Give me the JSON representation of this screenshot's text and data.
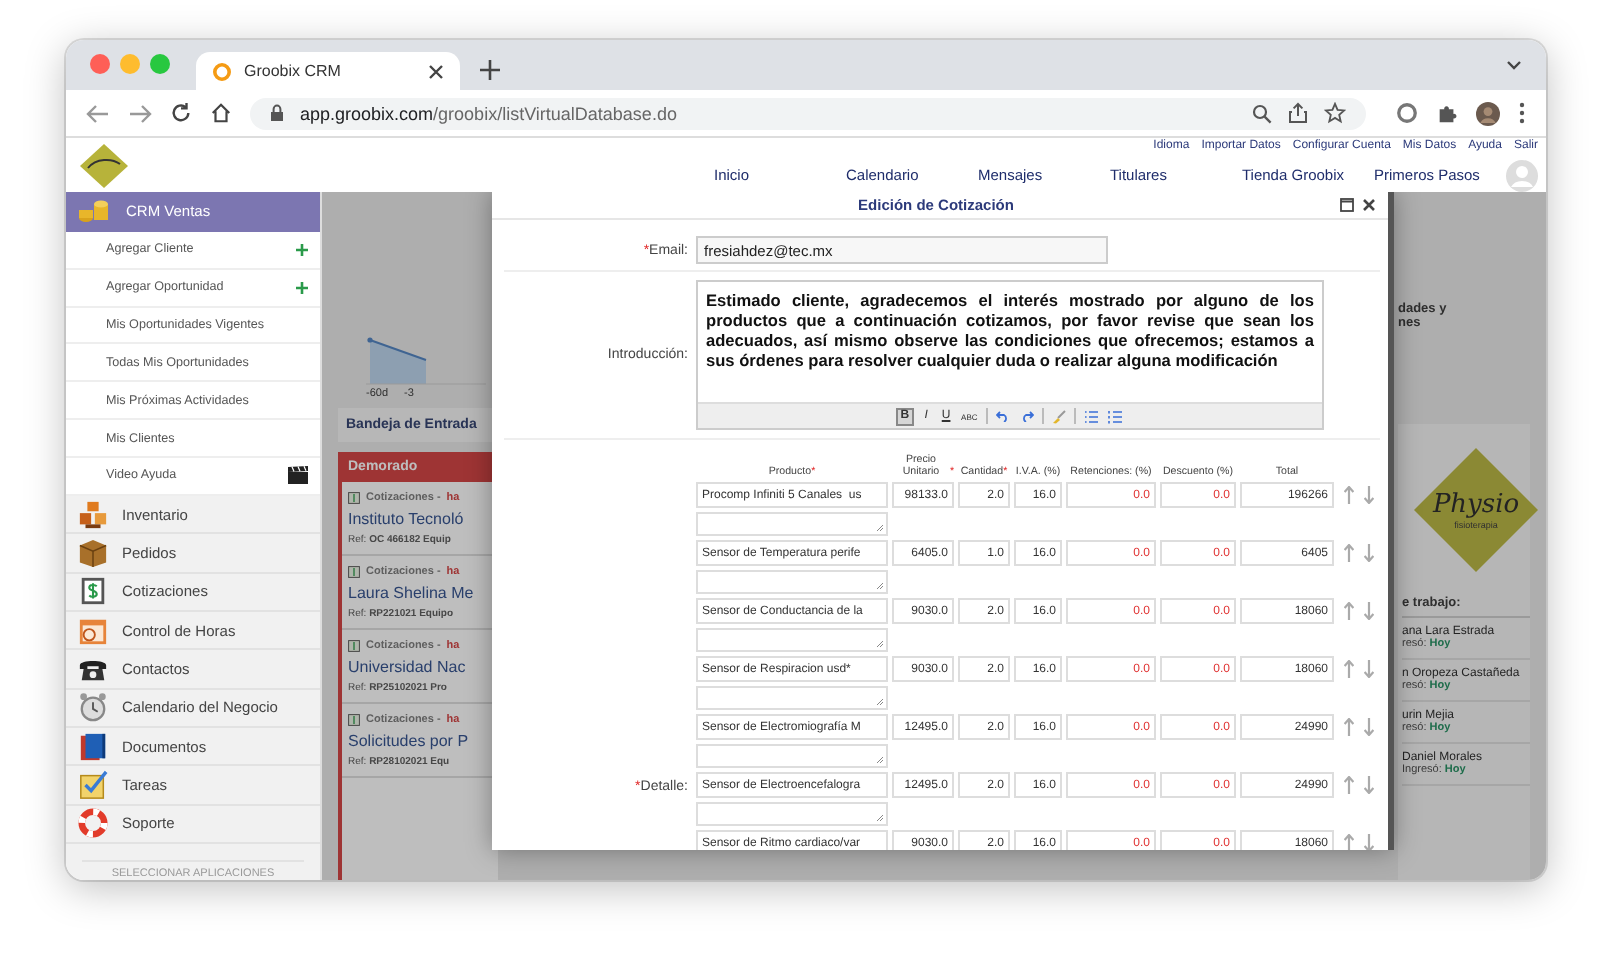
{
  "browser": {
    "tab_title": "Groobix CRM",
    "url_host": "app.groobix.com",
    "url_path": "/groobix/listVirtualDatabase.do"
  },
  "header": {
    "top_links": [
      "Idioma",
      "Importar Datos",
      "Configurar Cuenta",
      "Mis Datos",
      "Ayuda",
      "Salir"
    ],
    "nav": [
      "Inicio",
      "Calendario",
      "Mensajes",
      "Titulares",
      "Tienda Groobix",
      "Primeros Pasos"
    ]
  },
  "sidebar": {
    "section": {
      "label": "CRM Ventas",
      "expanded": true
    },
    "sub_items": [
      {
        "label": "Agregar Cliente",
        "kind": "add"
      },
      {
        "label": "Agregar Oportunidad",
        "kind": "add"
      },
      {
        "label": "Mis Oportunidades Vigentes",
        "kind": "link"
      },
      {
        "label": "Todas Mis Oportunidades",
        "kind": "link"
      },
      {
        "label": "Mis Próximas Actividades",
        "kind": "link"
      },
      {
        "label": "Mis Clientes",
        "kind": "link"
      },
      {
        "label": "Video Ayuda",
        "kind": "video"
      }
    ],
    "apps": [
      "Inventario",
      "Pedidos",
      "Cotizaciones",
      "Control de Horas",
      "Contactos",
      "Calendario del Negocio",
      "Documentos",
      "Tareas",
      "Soporte"
    ],
    "footer": "SELECCIONAR APLICACIONES"
  },
  "background": {
    "chart_ticks": [
      "-60d",
      "-3"
    ],
    "inbox_tab": "Bandeja de Entrada",
    "panel_title": "Demorado",
    "items": [
      {
        "category": "Cotizaciones -",
        "note": "ha",
        "title": "Instituto Tecnoló",
        "ref": "Ref: **OC 466182 Equip**"
      },
      {
        "category": "Cotizaciones -",
        "note": "ha",
        "title": "Laura Shelina Me",
        "ref": "Ref: **RP221021 Equipo**"
      },
      {
        "category": "Cotizaciones -",
        "note": "ha",
        "title": "Universidad Nac",
        "ref": "Ref: **RP25102021 Pro**"
      },
      {
        "category": "Cotizaciones -",
        "note": "ha",
        "title": "Solicitudes por P",
        "ref": "Ref: **RP28102021 Equ**"
      }
    ],
    "side_text": [
      "dades y",
      "nes"
    ],
    "logo_text": "Physio",
    "logo_subtext": "fisioterapia",
    "team_title": "e trabajo:",
    "team": [
      {
        "name": "ana Lara Estrada",
        "status": "resó:",
        "when": "Hoy"
      },
      {
        "name": "n Oropeza Castañeda",
        "status": "resó:",
        "when": "Hoy"
      },
      {
        "name": "urin Mejia",
        "status": "resó:",
        "when": "Hoy"
      },
      {
        "name": "Daniel Morales",
        "status": "Ingresó:",
        "when": "Hoy"
      }
    ]
  },
  "dialog": {
    "title": "Edición de Cotización",
    "required_mark": "*",
    "email": {
      "label": "Email:",
      "required": true,
      "value": "fresiahdez@tec.mx"
    },
    "introduction": {
      "label": "Introducción:",
      "required": false,
      "text": "Estimado cliente, agradecemos el interés mostrado por alguno de los productos que a continuación cotizamos, por favor revise que sean los adecuados, así mismo observe las condiciones que ofrecemos; estamos a sus órdenes para resolver cualquier duda o realizar alguna modificación",
      "toolbar": [
        {
          "kind": "text",
          "label": "B",
          "selected": true
        },
        {
          "kind": "text",
          "label": "I",
          "selected": false
        },
        {
          "kind": "text",
          "label": "U",
          "selected": false
        },
        {
          "kind": "text",
          "label": "ABC",
          "selected": false
        },
        {
          "kind": "undo",
          "selected": false
        },
        {
          "kind": "redo",
          "selected": false
        },
        {
          "kind": "clear",
          "selected": false
        },
        {
          "kind": "bullets",
          "selected": false
        },
        {
          "kind": "numbers",
          "selected": false
        }
      ]
    },
    "detail": {
      "label": "Detalle:",
      "required": true,
      "columns": [
        {
          "label": "Producto",
          "required": true
        },
        {
          "label": "Precio Unitario",
          "required": true
        },
        {
          "label": "Cantidad",
          "required": true
        },
        {
          "label": "I.V.A. (%)",
          "required": false
        },
        {
          "label": "Retenciones: (%)",
          "required": false
        },
        {
          "label": "Descuento (%)",
          "required": false
        },
        {
          "label": "Total",
          "required": false
        }
      ],
      "rows": [
        {
          "product": "Procomp Infiniti 5 Canales  us",
          "unit_price": "98133.0",
          "quantity": "2.0",
          "vat": "16.0",
          "retention": "0.0",
          "discount": "0.0",
          "total": "196266"
        },
        {
          "product": "Sensor de Temperatura perife",
          "unit_price": "6405.0",
          "quantity": "1.0",
          "vat": "16.0",
          "retention": "0.0",
          "discount": "0.0",
          "total": "6405"
        },
        {
          "product": "Sensor de Conductancia de la",
          "unit_price": "9030.0",
          "quantity": "2.0",
          "vat": "16.0",
          "retention": "0.0",
          "discount": "0.0",
          "total": "18060"
        },
        {
          "product": "Sensor de Respiracion usd*",
          "unit_price": "9030.0",
          "quantity": "2.0",
          "vat": "16.0",
          "retention": "0.0",
          "discount": "0.0",
          "total": "18060"
        },
        {
          "product": "Sensor de Electromiografía M",
          "unit_price": "12495.0",
          "quantity": "2.0",
          "vat": "16.0",
          "retention": "0.0",
          "discount": "0.0",
          "total": "24990"
        },
        {
          "product": "Sensor de Electroencefalogra",
          "unit_price": "12495.0",
          "quantity": "2.0",
          "vat": "16.0",
          "retention": "0.0",
          "discount": "0.0",
          "total": "24990"
        },
        {
          "product": "Sensor de Ritmo cardiaco/var",
          "unit_price": "9030.0",
          "quantity": "2.0",
          "vat": "16.0",
          "retention": "0.0",
          "discount": "0.0",
          "total": "18060"
        }
      ]
    }
  }
}
